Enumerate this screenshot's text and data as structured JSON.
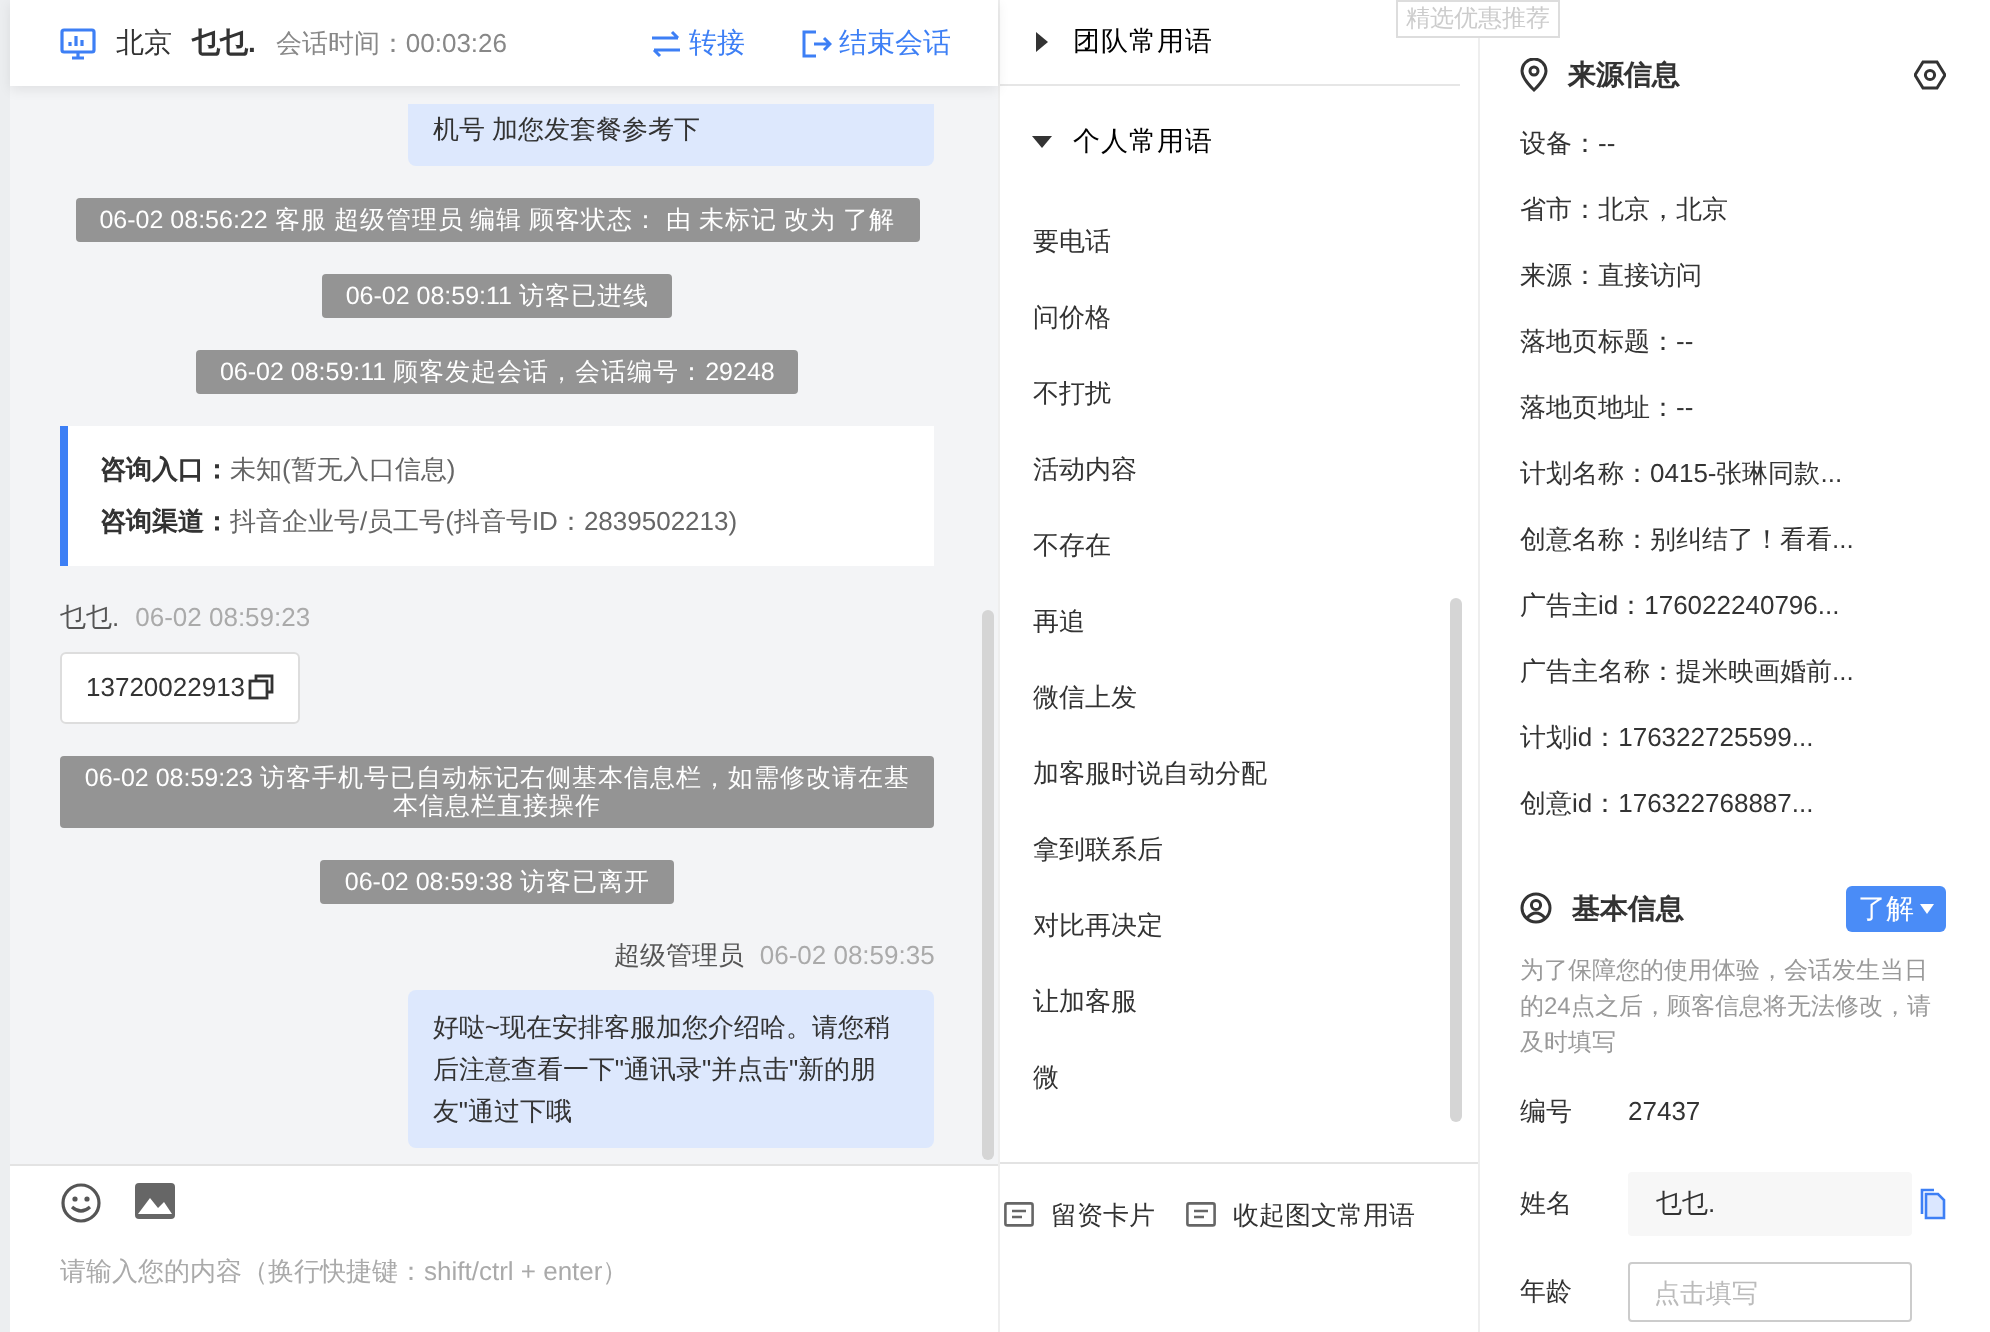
{
  "header": {
    "city": "北京",
    "visitor": "乜乜.",
    "session_time": "会话时间：00:03:26",
    "actions": [
      {
        "kind": "transfer",
        "label": "转接"
      },
      {
        "kind": "end",
        "label": "结束会话"
      }
    ]
  },
  "messages": [
    {
      "kind": "agent",
      "text": "机号 加您发套餐参考下"
    },
    {
      "kind": "system",
      "text": "06-02 08:56:22 客服 超级管理员 编辑 顾客状态： 由 未标记 改为 了解"
    },
    {
      "kind": "system",
      "text": "06-02 08:59:11 访客已进线"
    },
    {
      "kind": "system",
      "text": "06-02 08:59:11 顾客发起会话，会话编号：29248"
    },
    {
      "kind": "info",
      "entries": [
        {
          "label": "咨询入口：",
          "value": "未知(暂无入口信息)"
        },
        {
          "label": "咨询渠道：",
          "value": "抖音企业号/员工号(抖音号ID：2839502213)"
        }
      ]
    },
    {
      "kind": "visitor",
      "sender": "乜乜.",
      "time": "06-02 08:59:23",
      "text": "13720022913"
    },
    {
      "kind": "system",
      "text": "06-02 08:59:23 访客手机号已自动标记右侧基本信息栏，如需修改请在基本信息栏直接操作"
    },
    {
      "kind": "system",
      "text": "06-02 08:59:38 访客已离开"
    },
    {
      "kind": "agent",
      "sender": "超级管理员",
      "time": "06-02 08:59:35",
      "text": "好哒~现在安排客服加您介绍哈。请您稍后注意查看一下\"通讯录\"并点击\"新的朋友\"通过下哦"
    }
  ],
  "composer": {
    "placeholder": "请输入您的内容（换行快捷键：shift/ctrl + enter）"
  },
  "phrases": {
    "groups": [
      {
        "label": "团队常用语",
        "expanded": false
      },
      {
        "label": "个人常用语",
        "expanded": true,
        "items": [
          "要电话",
          "问价格",
          "不打扰",
          "活动内容",
          "不存在",
          "再追",
          "微信上发",
          "加客服时说自动分配",
          "拿到联系后",
          "对比再决定",
          "让加客服",
          "微"
        ]
      }
    ],
    "footer": [
      "留资卡片",
      "收起图文常用语"
    ]
  },
  "floating_tab": "精选优惠推荐",
  "source_info": {
    "title": "来源信息",
    "fields": [
      "设备：--",
      "省市：北京，北京",
      "来源：直接访问",
      "落地页标题：--",
      "落地页地址：--",
      "计划名称：0415-张琳同款...",
      "创意名称：别纠结了！看看...",
      "广告主id：176022240796...",
      "广告主名称：提米映画婚前...",
      "计划id：176322725599...",
      "创意id：176322768887..."
    ]
  },
  "basic_info": {
    "title": "基本信息",
    "status": "了解",
    "note": "为了保障您的使用体验，会话发生当日的24点之后，顾客信息将无法修改，请及时填写",
    "rows": [
      {
        "kind": "text",
        "label": "编号",
        "value": "27437"
      },
      {
        "kind": "field",
        "label": "姓名",
        "value": "乜乜."
      },
      {
        "kind": "input",
        "label": "年龄",
        "placeholder": "点击填写"
      }
    ]
  }
}
